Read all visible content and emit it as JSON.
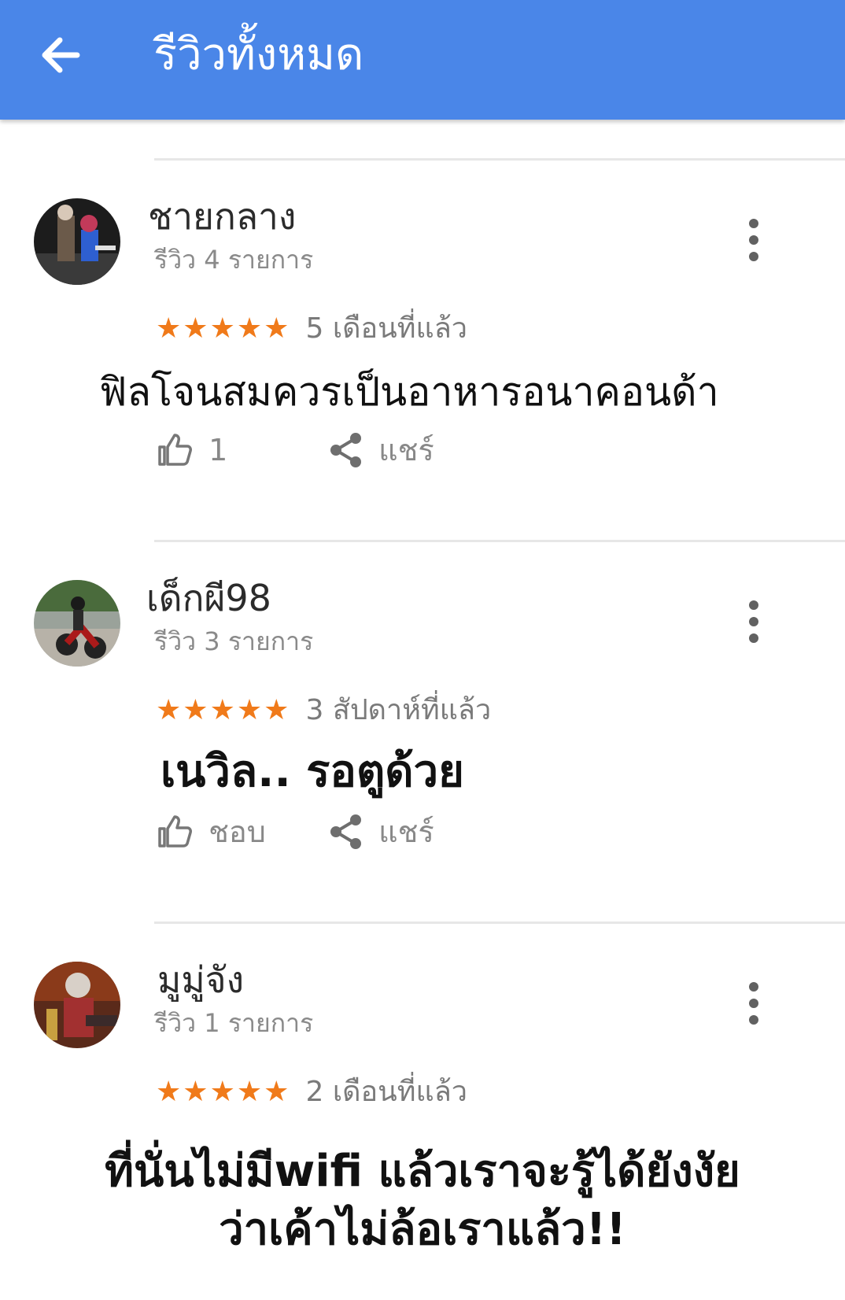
{
  "app_bar": {
    "title": "รีวิวทั้งหมด",
    "back_icon": "arrow-back-icon",
    "background": "#4a86e8"
  },
  "colors": {
    "star": "#f07a1a",
    "meta_text": "#8a8a8a"
  },
  "reviews": [
    {
      "name": "ชายกลาง",
      "review_count": "รีวิว 4 รายการ",
      "rating": 5,
      "time": "5 เดือนที่แล้ว",
      "comment": "ฟิลโจนสมควรเป็นอาหารอนาคอนด้า",
      "like_label": "1",
      "share_label": "แชร์"
    },
    {
      "name": "เด็กผี98",
      "review_count": "รีวิว 3 รายการ",
      "rating": 5,
      "time": "3 สัปดาห์ที่แล้ว",
      "comment": "เนวิล.. รอตูด้วย",
      "like_label": "ชอบ",
      "share_label": "แชร์"
    },
    {
      "name": "มูมู่จัง",
      "review_count": "รีวิว 1 รายการ",
      "rating": 5,
      "time": "2 เดือนที่แล้ว",
      "comment": "ที่นั่นไม่มีwifi แล้วเราจะรู้ได้ยังงัย\nว่าเค้าไม่ล้อเราแล้ว!!",
      "like_label": "",
      "share_label": ""
    }
  ]
}
